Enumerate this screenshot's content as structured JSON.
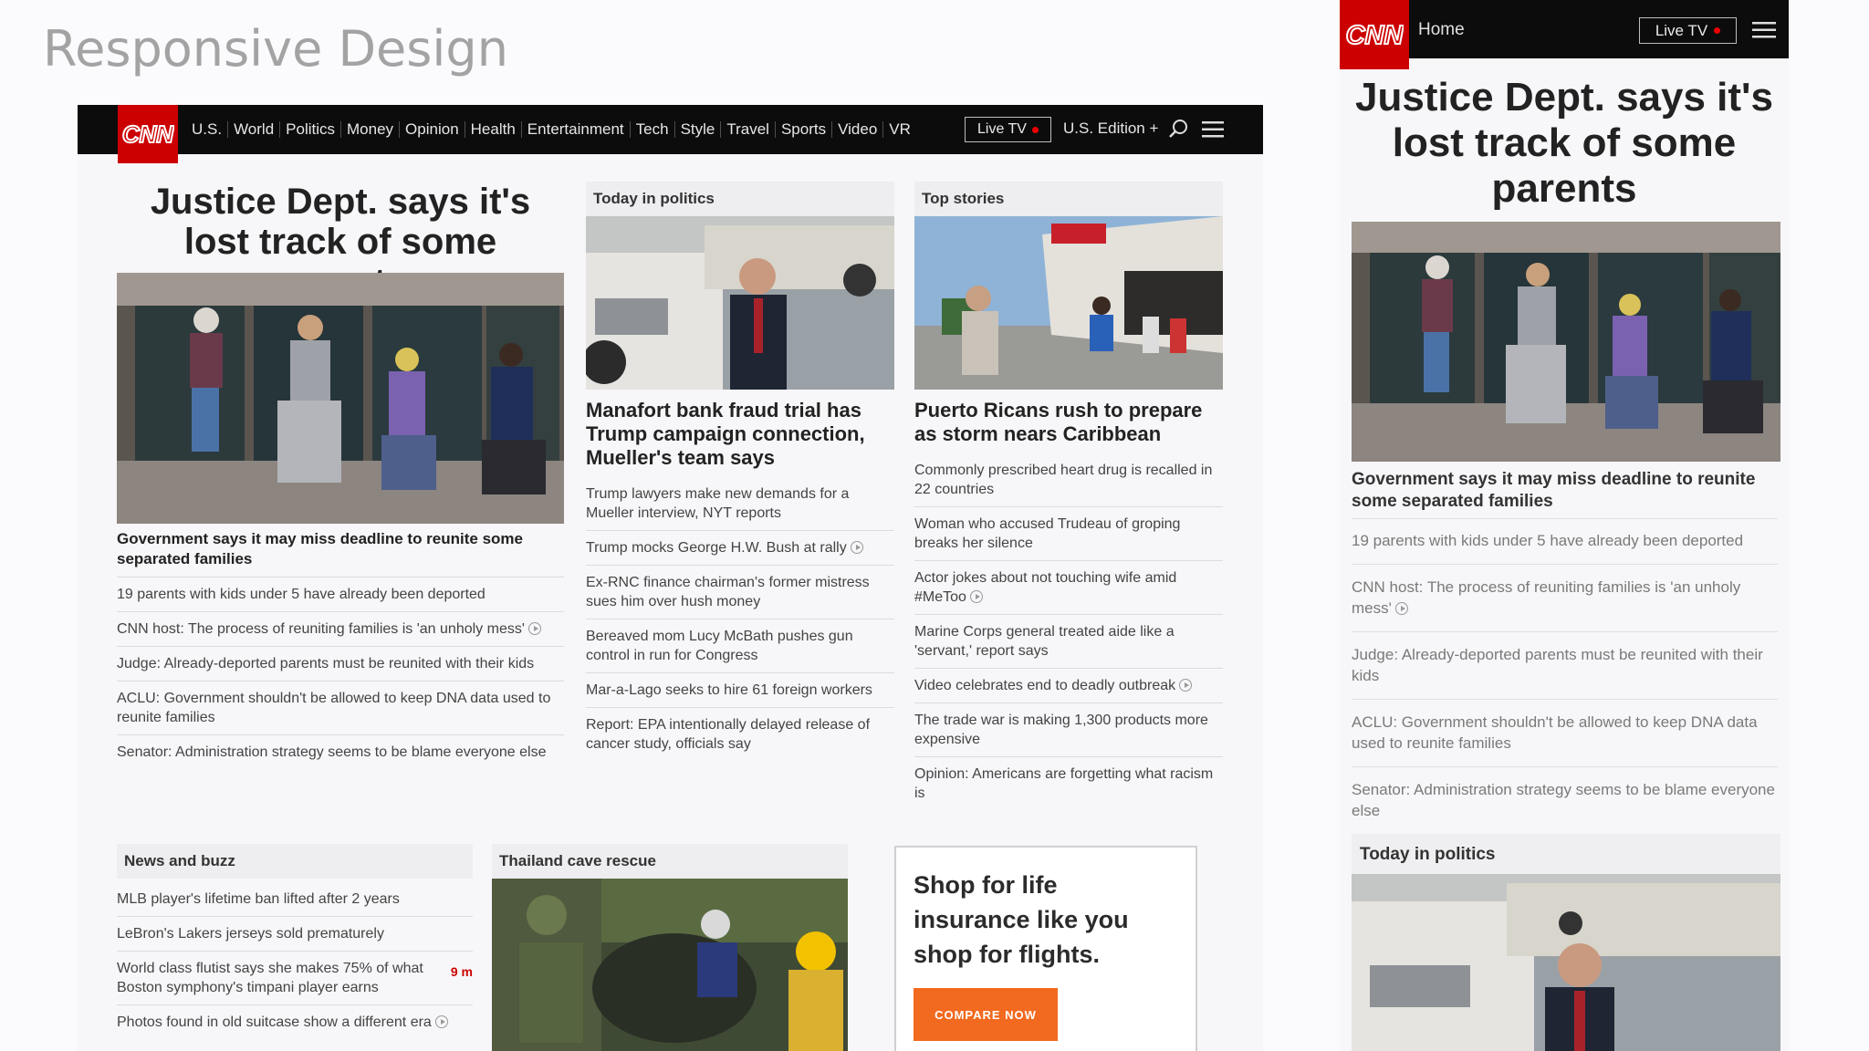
{
  "slide": {
    "title": "Responsive Design"
  },
  "desktop": {
    "nav": {
      "logo": "CNN",
      "links": [
        "U.S.",
        "World",
        "Politics",
        "Money",
        "Opinion",
        "Health",
        "Entertainment",
        "Tech",
        "Style",
        "Travel",
        "Sports",
        "Video",
        "VR"
      ],
      "live_tv": "Live TV",
      "edition": "U.S. Edition +"
    },
    "lead": {
      "headline": "Justice Dept. says it's lost track of some parents",
      "subhead": "Government says it may miss deadline to reunite some separated families",
      "items": [
        {
          "text": "19 parents with kids under 5 have already been deported",
          "video": false
        },
        {
          "text": "CNN host: The process of reuniting families is 'an unholy mess'",
          "video": true
        },
        {
          "text": "Judge: Already-deported parents must be reunited with their kids",
          "video": false
        },
        {
          "text": "ACLU: Government shouldn't be allowed to keep DNA data used to reunite families",
          "video": false
        },
        {
          "text": "Senator: Administration strategy seems to be blame everyone else",
          "video": false
        }
      ]
    },
    "politics": {
      "section": "Today in politics",
      "headline": "Manafort bank fraud trial has Trump campaign connection, Mueller's team says",
      "items": [
        {
          "text": "Trump lawyers make new demands for a Mueller interview, NYT reports",
          "video": false
        },
        {
          "text": "Trump mocks George H.W. Bush at rally",
          "video": true
        },
        {
          "text": "Ex-RNC finance chairman's former mistress sues him over hush money",
          "video": false
        },
        {
          "text": "Bereaved mom Lucy McBath pushes gun control in run for Congress",
          "video": false
        },
        {
          "text": "Mar-a-Lago seeks to hire 61 foreign workers",
          "video": false
        },
        {
          "text": "Report: EPA intentionally delayed release of cancer study, officials say",
          "video": false
        }
      ]
    },
    "top": {
      "section": "Top stories",
      "headline": "Puerto Ricans rush to prepare as storm nears Caribbean",
      "items": [
        {
          "text": "Commonly prescribed heart drug is recalled in 22 countries",
          "video": false
        },
        {
          "text": "Woman who accused Trudeau of groping breaks her silence",
          "video": false
        },
        {
          "text": "Actor jokes about not touching wife amid #MeToo",
          "video": true
        },
        {
          "text": "Marine Corps general treated aide like a 'servant,' report says",
          "video": false
        },
        {
          "text": "Video celebrates end to deadly outbreak",
          "video": true
        },
        {
          "text": "The trade war is making 1,300 products more expensive",
          "video": false
        },
        {
          "text": "Opinion: Americans are forgetting what racism is",
          "video": false
        }
      ]
    },
    "buzz": {
      "section": "News and buzz",
      "items": [
        {
          "text": "MLB player's lifetime ban lifted after 2 years",
          "video": false,
          "ago": ""
        },
        {
          "text": "LeBron's Lakers jerseys sold prematurely",
          "video": false,
          "ago": ""
        },
        {
          "text": "World class flutist says she makes 75% of what Boston symphony's timpani player earns",
          "video": false,
          "ago": "9 m"
        },
        {
          "text": "Photos found in old suitcase show a different era",
          "video": true,
          "ago": ""
        }
      ]
    },
    "cave": {
      "section": "Thailand cave rescue"
    },
    "ad": {
      "text": "Shop for life insurance like you shop for flights.",
      "button": "COMPARE NOW"
    }
  },
  "mobile": {
    "nav": {
      "logo": "CNN",
      "home": "Home",
      "live_tv": "Live TV"
    },
    "headline": "Justice Dept. says it's lost track of some parents",
    "subhead": "Government says it may miss deadline to reunite some separated families",
    "items": [
      {
        "text": "19 parents with kids under 5 have already been deported",
        "video": false
      },
      {
        "text": "CNN host: The process of reuniting families is 'an unholy mess'",
        "video": true
      },
      {
        "text": "Judge: Already-deported parents must be reunited with their kids",
        "video": false
      },
      {
        "text": "ACLU: Government shouldn't be allowed to keep DNA data used to reunite families",
        "video": false
      },
      {
        "text": "Senator: Administration strategy seems to be blame everyone else",
        "video": false
      }
    ],
    "section": "Today in politics"
  },
  "colors": {
    "brand": "#cc0000",
    "nav_bg": "#0c0c0c",
    "ad_button": "#f26a1f"
  }
}
